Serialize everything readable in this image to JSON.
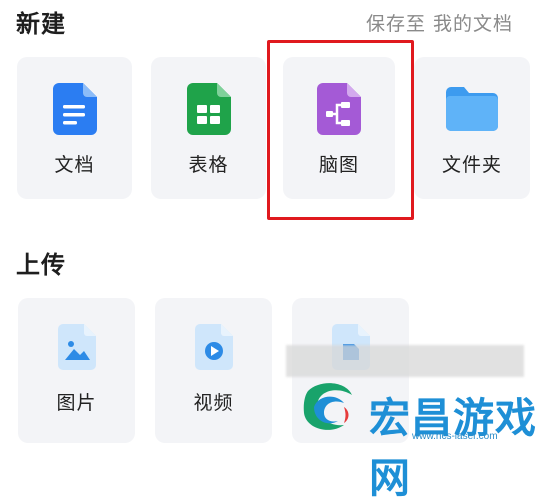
{
  "new_section": {
    "title": "新建",
    "save_hint": "保存至 我的文档",
    "items": [
      {
        "label": "文档",
        "icon": "document-icon",
        "color": "#2b7df2"
      },
      {
        "label": "表格",
        "icon": "spreadsheet-icon",
        "color": "#1fa34a"
      },
      {
        "label": "脑图",
        "icon": "mindmap-icon",
        "color": "#a45ad6"
      },
      {
        "label": "文件夹",
        "icon": "folder-icon",
        "color": "#4aa8f5"
      }
    ]
  },
  "upload_section": {
    "title": "上传",
    "items": [
      {
        "label": "图片",
        "icon": "image-icon"
      },
      {
        "label": "视频",
        "icon": "video-icon"
      },
      {
        "label": "",
        "icon": "file-icon"
      }
    ]
  },
  "watermark": {
    "text": "宏昌游戏网",
    "url": "www.hcs-laser.com"
  },
  "colors": {
    "highlight": "#e0191e",
    "card_bg": "#f3f4f7"
  }
}
